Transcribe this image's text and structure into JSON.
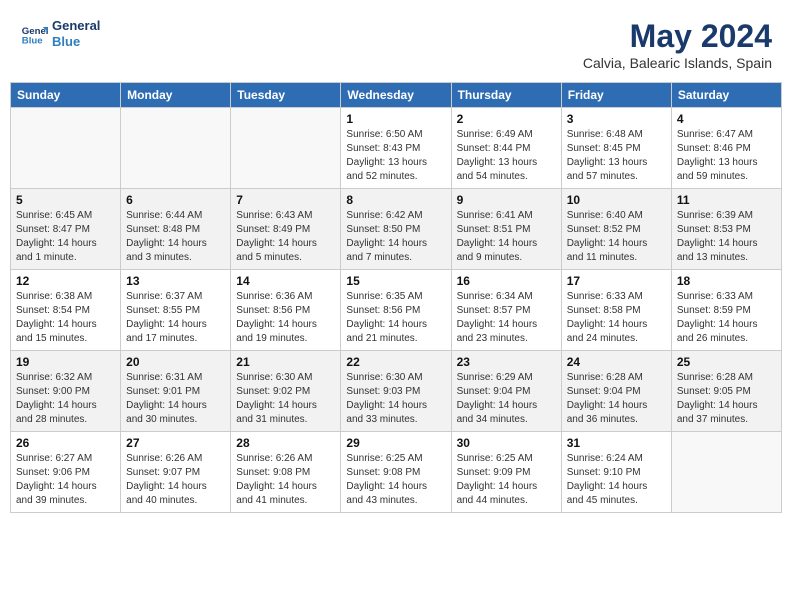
{
  "header": {
    "logo_line1": "General",
    "logo_line2": "Blue",
    "title": "May 2024",
    "subtitle": "Calvia, Balearic Islands, Spain"
  },
  "columns": [
    "Sunday",
    "Monday",
    "Tuesday",
    "Wednesday",
    "Thursday",
    "Friday",
    "Saturday"
  ],
  "weeks": [
    [
      {
        "day": "",
        "sunrise": "",
        "sunset": "",
        "daylight": "",
        "empty": true
      },
      {
        "day": "",
        "sunrise": "",
        "sunset": "",
        "daylight": "",
        "empty": true
      },
      {
        "day": "",
        "sunrise": "",
        "sunset": "",
        "daylight": "",
        "empty": true
      },
      {
        "day": "1",
        "sunrise": "Sunrise: 6:50 AM",
        "sunset": "Sunset: 8:43 PM",
        "daylight": "Daylight: 13 hours and 52 minutes."
      },
      {
        "day": "2",
        "sunrise": "Sunrise: 6:49 AM",
        "sunset": "Sunset: 8:44 PM",
        "daylight": "Daylight: 13 hours and 54 minutes."
      },
      {
        "day": "3",
        "sunrise": "Sunrise: 6:48 AM",
        "sunset": "Sunset: 8:45 PM",
        "daylight": "Daylight: 13 hours and 57 minutes."
      },
      {
        "day": "4",
        "sunrise": "Sunrise: 6:47 AM",
        "sunset": "Sunset: 8:46 PM",
        "daylight": "Daylight: 13 hours and 59 minutes."
      }
    ],
    [
      {
        "day": "5",
        "sunrise": "Sunrise: 6:45 AM",
        "sunset": "Sunset: 8:47 PM",
        "daylight": "Daylight: 14 hours and 1 minute."
      },
      {
        "day": "6",
        "sunrise": "Sunrise: 6:44 AM",
        "sunset": "Sunset: 8:48 PM",
        "daylight": "Daylight: 14 hours and 3 minutes."
      },
      {
        "day": "7",
        "sunrise": "Sunrise: 6:43 AM",
        "sunset": "Sunset: 8:49 PM",
        "daylight": "Daylight: 14 hours and 5 minutes."
      },
      {
        "day": "8",
        "sunrise": "Sunrise: 6:42 AM",
        "sunset": "Sunset: 8:50 PM",
        "daylight": "Daylight: 14 hours and 7 minutes."
      },
      {
        "day": "9",
        "sunrise": "Sunrise: 6:41 AM",
        "sunset": "Sunset: 8:51 PM",
        "daylight": "Daylight: 14 hours and 9 minutes."
      },
      {
        "day": "10",
        "sunrise": "Sunrise: 6:40 AM",
        "sunset": "Sunset: 8:52 PM",
        "daylight": "Daylight: 14 hours and 11 minutes."
      },
      {
        "day": "11",
        "sunrise": "Sunrise: 6:39 AM",
        "sunset": "Sunset: 8:53 PM",
        "daylight": "Daylight: 14 hours and 13 minutes."
      }
    ],
    [
      {
        "day": "12",
        "sunrise": "Sunrise: 6:38 AM",
        "sunset": "Sunset: 8:54 PM",
        "daylight": "Daylight: 14 hours and 15 minutes."
      },
      {
        "day": "13",
        "sunrise": "Sunrise: 6:37 AM",
        "sunset": "Sunset: 8:55 PM",
        "daylight": "Daylight: 14 hours and 17 minutes."
      },
      {
        "day": "14",
        "sunrise": "Sunrise: 6:36 AM",
        "sunset": "Sunset: 8:56 PM",
        "daylight": "Daylight: 14 hours and 19 minutes."
      },
      {
        "day": "15",
        "sunrise": "Sunrise: 6:35 AM",
        "sunset": "Sunset: 8:56 PM",
        "daylight": "Daylight: 14 hours and 21 minutes."
      },
      {
        "day": "16",
        "sunrise": "Sunrise: 6:34 AM",
        "sunset": "Sunset: 8:57 PM",
        "daylight": "Daylight: 14 hours and 23 minutes."
      },
      {
        "day": "17",
        "sunrise": "Sunrise: 6:33 AM",
        "sunset": "Sunset: 8:58 PM",
        "daylight": "Daylight: 14 hours and 24 minutes."
      },
      {
        "day": "18",
        "sunrise": "Sunrise: 6:33 AM",
        "sunset": "Sunset: 8:59 PM",
        "daylight": "Daylight: 14 hours and 26 minutes."
      }
    ],
    [
      {
        "day": "19",
        "sunrise": "Sunrise: 6:32 AM",
        "sunset": "Sunset: 9:00 PM",
        "daylight": "Daylight: 14 hours and 28 minutes."
      },
      {
        "day": "20",
        "sunrise": "Sunrise: 6:31 AM",
        "sunset": "Sunset: 9:01 PM",
        "daylight": "Daylight: 14 hours and 30 minutes."
      },
      {
        "day": "21",
        "sunrise": "Sunrise: 6:30 AM",
        "sunset": "Sunset: 9:02 PM",
        "daylight": "Daylight: 14 hours and 31 minutes."
      },
      {
        "day": "22",
        "sunrise": "Sunrise: 6:30 AM",
        "sunset": "Sunset: 9:03 PM",
        "daylight": "Daylight: 14 hours and 33 minutes."
      },
      {
        "day": "23",
        "sunrise": "Sunrise: 6:29 AM",
        "sunset": "Sunset: 9:04 PM",
        "daylight": "Daylight: 14 hours and 34 minutes."
      },
      {
        "day": "24",
        "sunrise": "Sunrise: 6:28 AM",
        "sunset": "Sunset: 9:04 PM",
        "daylight": "Daylight: 14 hours and 36 minutes."
      },
      {
        "day": "25",
        "sunrise": "Sunrise: 6:28 AM",
        "sunset": "Sunset: 9:05 PM",
        "daylight": "Daylight: 14 hours and 37 minutes."
      }
    ],
    [
      {
        "day": "26",
        "sunrise": "Sunrise: 6:27 AM",
        "sunset": "Sunset: 9:06 PM",
        "daylight": "Daylight: 14 hours and 39 minutes."
      },
      {
        "day": "27",
        "sunrise": "Sunrise: 6:26 AM",
        "sunset": "Sunset: 9:07 PM",
        "daylight": "Daylight: 14 hours and 40 minutes."
      },
      {
        "day": "28",
        "sunrise": "Sunrise: 6:26 AM",
        "sunset": "Sunset: 9:08 PM",
        "daylight": "Daylight: 14 hours and 41 minutes."
      },
      {
        "day": "29",
        "sunrise": "Sunrise: 6:25 AM",
        "sunset": "Sunset: 9:08 PM",
        "daylight": "Daylight: 14 hours and 43 minutes."
      },
      {
        "day": "30",
        "sunrise": "Sunrise: 6:25 AM",
        "sunset": "Sunset: 9:09 PM",
        "daylight": "Daylight: 14 hours and 44 minutes."
      },
      {
        "day": "31",
        "sunrise": "Sunrise: 6:24 AM",
        "sunset": "Sunset: 9:10 PM",
        "daylight": "Daylight: 14 hours and 45 minutes."
      },
      {
        "day": "",
        "sunrise": "",
        "sunset": "",
        "daylight": "",
        "empty": true
      }
    ]
  ]
}
